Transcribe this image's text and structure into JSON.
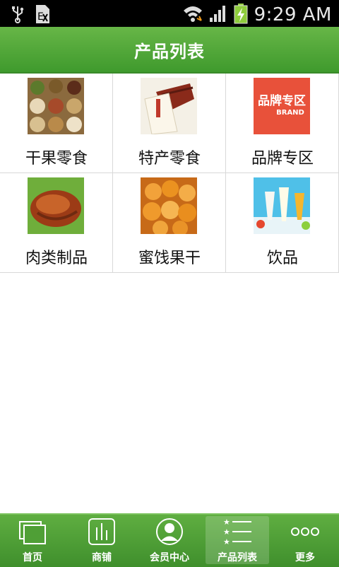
{
  "status_bar": {
    "time": "9:29 AM",
    "icons": [
      "usb-icon",
      "sim-card-icon",
      "wifi-icon",
      "signal-icon",
      "battery-charging-icon"
    ]
  },
  "header": {
    "title": "产品列表"
  },
  "categories": [
    {
      "label": "干果零食",
      "icon": "dried-fruit-snacks-image"
    },
    {
      "label": "特产零食",
      "icon": "specialty-snacks-image"
    },
    {
      "label": "品牌专区",
      "icon": "brand-zone-image",
      "badge_text": "品牌专区",
      "badge_sub": "BRAND"
    },
    {
      "label": "肉类制品",
      "icon": "meat-products-image"
    },
    {
      "label": "蜜饯果干",
      "icon": "candied-fruit-image"
    },
    {
      "label": "饮品",
      "icon": "drinks-image"
    }
  ],
  "tabbar": {
    "active_index": 3,
    "items": [
      {
        "label": "首页",
        "icon": "home-icon"
      },
      {
        "label": "商铺",
        "icon": "shop-icon"
      },
      {
        "label": "会员中心",
        "icon": "member-icon"
      },
      {
        "label": "产品列表",
        "icon": "list-icon"
      },
      {
        "label": "更多",
        "icon": "more-icon"
      }
    ]
  },
  "colors": {
    "header_green": "#4fa536",
    "tab_green": "#4f9f36",
    "brand_red": "#e8513a"
  }
}
